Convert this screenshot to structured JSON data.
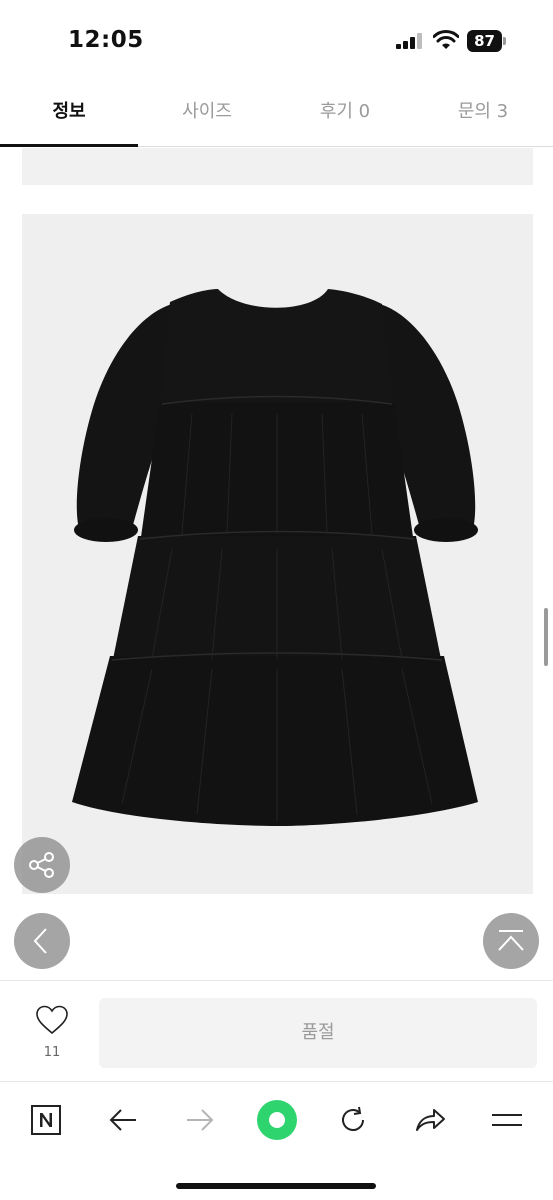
{
  "status": {
    "time": "12:05",
    "battery": "87"
  },
  "tabs": [
    {
      "label": "정보",
      "active": true
    },
    {
      "label": "사이즈",
      "active": false
    },
    {
      "label": "후기 0",
      "active": false
    },
    {
      "label": "문의 3",
      "active": false
    }
  ],
  "content": {
    "partial_text": "",
    "image": {
      "subject": "black tiered dress",
      "background": "#efefef"
    }
  },
  "purchase": {
    "like_count": "11",
    "soldout_label": "품절"
  },
  "icons": {
    "share": "share-icon",
    "back": "chevron-left-icon",
    "top": "chevron-up-icon",
    "like": "heart-icon",
    "naver": "naver-n-icon",
    "prev": "arrow-left-icon",
    "next": "arrow-right-icon",
    "green": "green-circle-icon",
    "reload": "reload-icon",
    "forward_share": "forward-share-icon",
    "menu": "menu-icon"
  },
  "colors": {
    "accent_green": "#2ed46d",
    "tab_active": "#111111",
    "tab_inactive": "#9a9a9a"
  }
}
